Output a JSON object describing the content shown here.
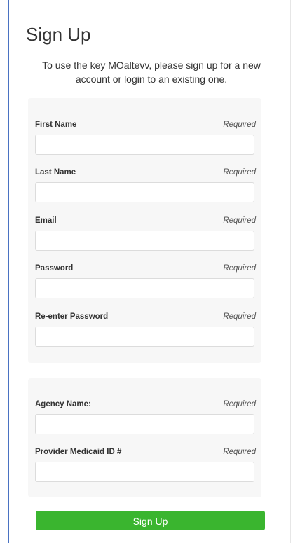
{
  "title": "Sign Up",
  "intro": "To use the key MOaltevv, please sign up for a new account or login to an existing one.",
  "required_text": "Required",
  "account_fields": [
    {
      "label": "First Name",
      "value": "",
      "placeholder": ""
    },
    {
      "label": "Last Name",
      "value": "",
      "placeholder": ""
    },
    {
      "label": "Email",
      "value": "",
      "placeholder": ""
    },
    {
      "label": "Password",
      "value": "",
      "placeholder": ""
    },
    {
      "label": "Re-enter Password",
      "value": "",
      "placeholder": ""
    }
  ],
  "agency_fields": [
    {
      "label": "Agency Name:",
      "value": "",
      "placeholder": ""
    },
    {
      "label": "Provider Medicaid ID #",
      "value": "",
      "placeholder": ""
    }
  ],
  "submit_label": "Sign Up",
  "colors": {
    "accent_border": "#4a72c2",
    "button": "#3ab52f"
  }
}
